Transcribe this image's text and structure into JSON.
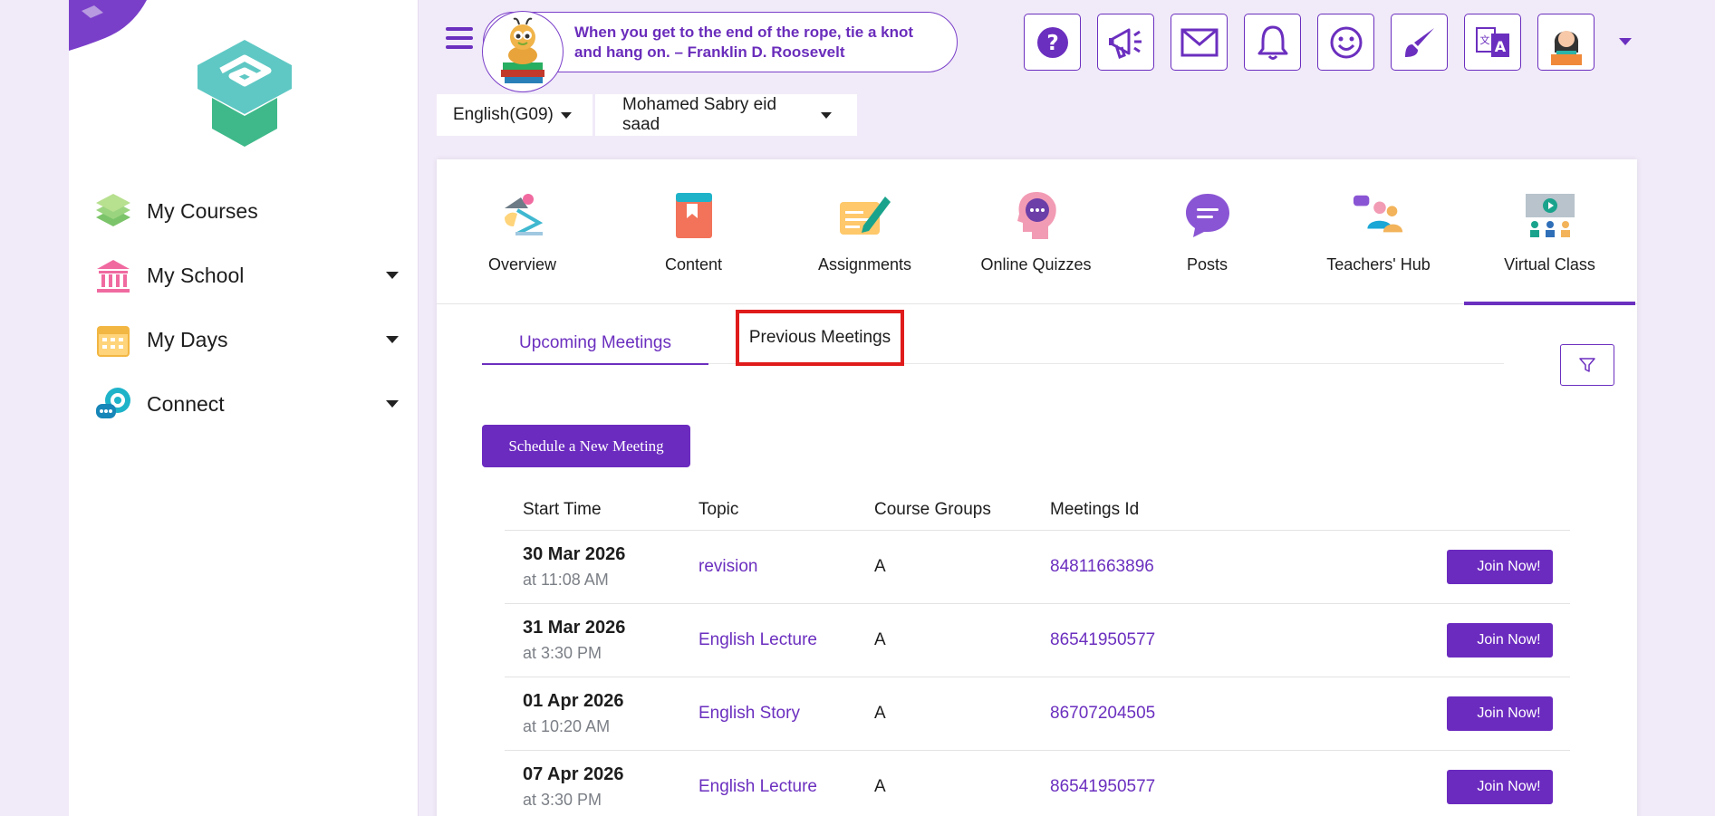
{
  "sidebar": {
    "items": [
      {
        "label": "My Courses",
        "icon": "books-stack-icon",
        "has_dropdown": false
      },
      {
        "label": "My School",
        "icon": "school-building-icon",
        "has_dropdown": true
      },
      {
        "label": "My Days",
        "icon": "calendar-icon",
        "has_dropdown": true
      },
      {
        "label": "Connect",
        "icon": "chat-bubble-icon",
        "has_dropdown": true
      }
    ]
  },
  "header": {
    "quote": "When you get to the end of the rope, tie a knot and hang on. – Franklin D. Roosevelt",
    "buttons": [
      "help-icon",
      "megaphone-icon",
      "mail-icon",
      "bell-icon",
      "smiley-icon",
      "brush-icon",
      "translate-icon",
      "profile-avatar"
    ]
  },
  "breadcrumbs": {
    "course": "English(G09)",
    "teacher": "Mohamed Sabry eid saad"
  },
  "course_tabs": [
    {
      "label": "Overview",
      "icon": "lamp-icon"
    },
    {
      "label": "Content",
      "icon": "book-icon"
    },
    {
      "label": "Assignments",
      "icon": "pen-paper-icon"
    },
    {
      "label": "Online Quizzes",
      "icon": "head-thought-icon"
    },
    {
      "label": "Posts",
      "icon": "speech-bubble-icon"
    },
    {
      "label": "Teachers' Hub",
      "icon": "people-group-icon"
    },
    {
      "label": "Virtual Class",
      "icon": "classroom-screen-icon"
    }
  ],
  "meetings": {
    "tab_upcoming": "Upcoming Meetings",
    "tab_previous": "Previous Meetings",
    "schedule_label": "Schedule a New Meeting",
    "columns": [
      "Start Time",
      "Topic",
      "Course Groups",
      "Meetings Id"
    ],
    "join_label": "Join Now!",
    "rows": [
      {
        "date": "30 Mar 2026",
        "time": "at 11:08 AM",
        "topic": "revision",
        "group": "A",
        "id": "84811663896"
      },
      {
        "date": "31 Mar 2026",
        "time": "at 3:30 PM",
        "topic": "English Lecture",
        "group": "A",
        "id": "86541950577"
      },
      {
        "date": "01 Apr 2026",
        "time": "at 10:20 AM",
        "topic": "English Story",
        "group": "A",
        "id": "86707204505"
      },
      {
        "date": "07 Apr 2026",
        "time": "at 3:30 PM",
        "topic": "English Lecture",
        "group": "A",
        "id": "86541950577"
      }
    ]
  },
  "colors": {
    "accent": "#6b2fbf",
    "background": "#f1eaf8",
    "highlight_box": "#e01b1b"
  }
}
